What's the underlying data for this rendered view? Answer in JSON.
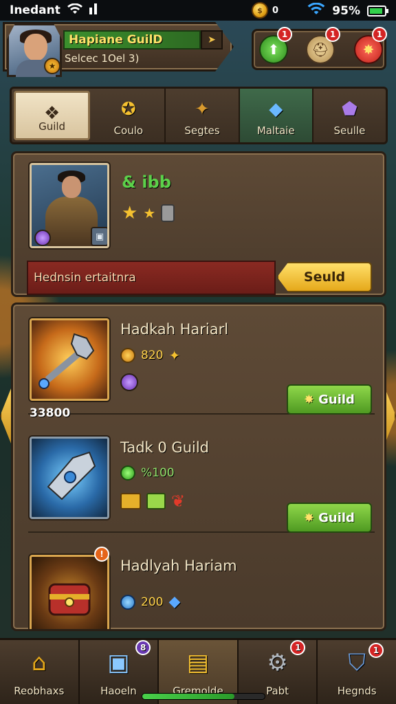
{
  "status": {
    "carrier": "Inedant",
    "coin_count": "0",
    "battery": "95%"
  },
  "header": {
    "guild_name": "Hapiane GuilD",
    "guild_sub": "Selcec 1Oel 3)"
  },
  "topicons": {
    "badge1": "1",
    "badge2": "1",
    "badge3": "1"
  },
  "tabs": [
    {
      "label": "Guild"
    },
    {
      "label": "Coulo"
    },
    {
      "label": "Segtes"
    },
    {
      "label": "Maltaie"
    },
    {
      "label": "Seulle"
    }
  ],
  "hero": {
    "name": "& ibb",
    "bar_text": "Hednsin ertaitnra",
    "button": "Seuld"
  },
  "items": [
    {
      "title": "Hadkah Hariarl",
      "cost": "820",
      "value": "33800",
      "button": "Guild"
    },
    {
      "title": "Tadk 0 Guild",
      "cost": "%100",
      "button": "Guild"
    },
    {
      "title": "Hadlyah Hariam",
      "cost": "200"
    }
  ],
  "nav": [
    {
      "label": "Reobhaxs"
    },
    {
      "label": "Haoeln",
      "badge": "8"
    },
    {
      "label": "Gremolde"
    },
    {
      "label": "Pabt",
      "badge": "1"
    },
    {
      "label": "Hegnds",
      "badge": "1"
    }
  ],
  "progress": {
    "value": 0.75
  },
  "colors": {
    "accent_green": "#4f9a22",
    "accent_gold": "#e5a81a",
    "panel": "#5e4a36"
  }
}
